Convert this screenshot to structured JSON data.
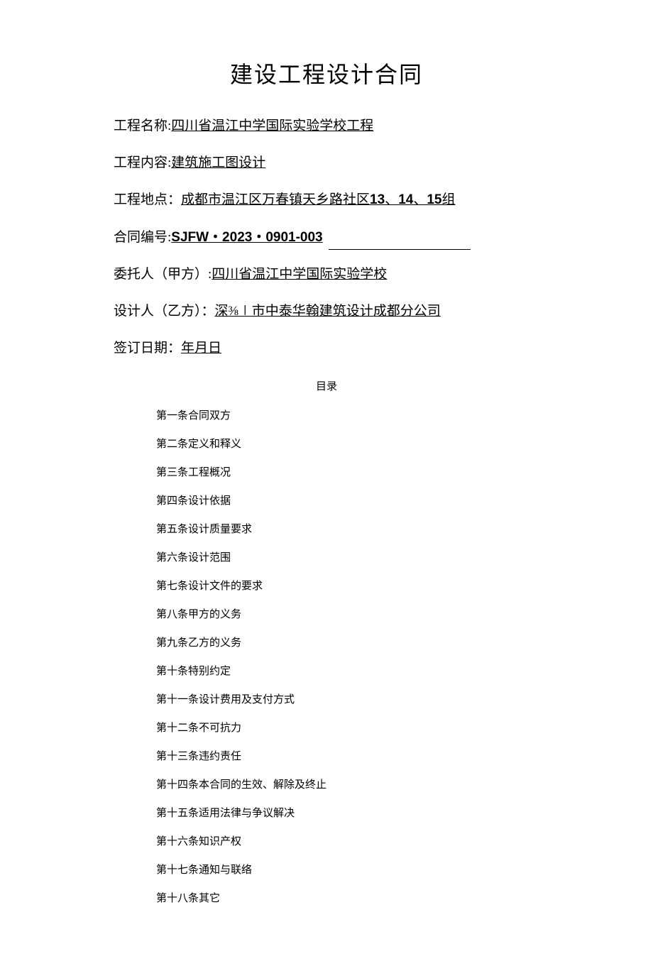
{
  "title": "建设工程设计合同",
  "info": {
    "project_name_label": "工程名称:",
    "project_name_value": "四川省温江中学国际实验学校工程",
    "project_content_label": "工程内容:",
    "project_content_value": "建筑施工图设计",
    "project_location_label": "工程地点：",
    "project_location_prefix": "成都市温江区万春镇天乡路社区",
    "project_location_num1": "13",
    "project_location_sep1": "、",
    "project_location_num2": "14",
    "project_location_sep2": "、",
    "project_location_num3": "15",
    "project_location_suffix": "组",
    "contract_no_label": "合同编号:",
    "contract_no_value": "SJFW・2023・0901-003",
    "party_a_label": "委托人（甲方）:",
    "party_a_value": "四川省温江中学国际实验学校",
    "party_b_label": "设计人（乙方）：",
    "party_b_value": "深⅜∣市中泰华翰建筑设计成都分公司",
    "sign_date_label": "签订日期：",
    "sign_date_value": "年月日"
  },
  "toc": {
    "header": "目录",
    "items": [
      "第一条合同双方",
      "第二条定义和释义",
      "第三条工程概况",
      "第四条设计依据",
      "第五条设计质量要求",
      "第六条设计范围",
      "第七条设计文件的要求",
      "第八条甲方的义务",
      "第九条乙方的义务",
      "第十条特别约定",
      "第十一条设计费用及支付方式",
      "第十二条不可抗力",
      "第十三条违约责任",
      "第十四条本合同的生效、解除及终止",
      "第十五条适用法律与争议解决",
      "第十六条知识产权",
      "第十七条通知与联络",
      "第十八条其它"
    ]
  }
}
